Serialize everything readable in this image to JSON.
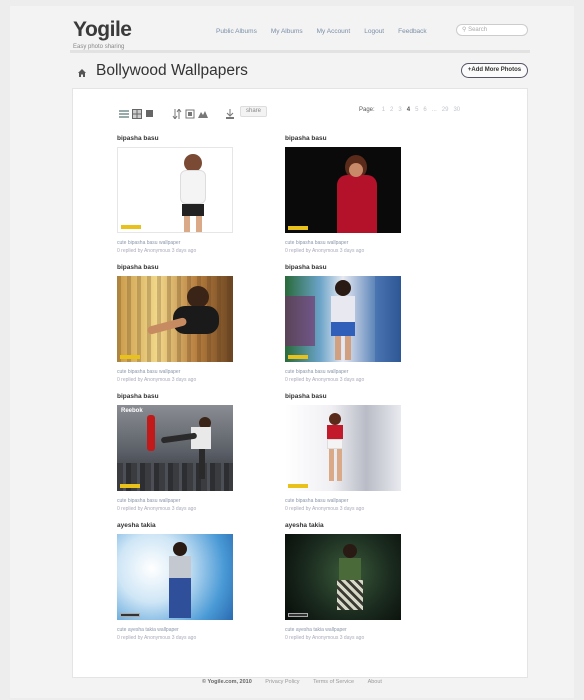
{
  "header": {
    "logo": "Yogile",
    "tagline": "Easy photo sharing",
    "nav": [
      "Public Albums",
      "My Albums",
      "My Account",
      "Logout",
      "Feedback"
    ],
    "search_placeholder": "Search"
  },
  "album": {
    "title": "Bollywood Wallpapers",
    "add_button": "+Add More Photos"
  },
  "toolbar": {
    "share_label": "share",
    "icons": [
      "list-view-icon",
      "grid-view-icon",
      "single-view-icon",
      "sort-icon",
      "slideshow-icon",
      "map-icon",
      "download-icon"
    ]
  },
  "pager": {
    "label": "Page:",
    "pages": [
      "1",
      "2",
      "3",
      "4",
      "5",
      "6",
      "...",
      "29",
      "30"
    ],
    "current": "4"
  },
  "photos": [
    {
      "name": "bipasha basu",
      "caption": "cute bipasha basu wallpaper",
      "meta": "0 replied by Anonymous 3 days ago"
    },
    {
      "name": "bipasha basu",
      "caption": "cute bipasha basu wallpaper",
      "meta": "0 replied by Anonymous 3 days ago"
    },
    {
      "name": "bipasha basu",
      "caption": "cute bipasha basu wallpaper",
      "meta": "0 replied by Anonymous 3 days ago"
    },
    {
      "name": "bipasha basu",
      "caption": "cute bipasha basu wallpaper",
      "meta": "0 replied by Anonymous 3 days ago"
    },
    {
      "name": "bipasha basu",
      "caption": "cute bipasha basu wallpaper",
      "meta": "0 replied by Anonymous 3 days ago",
      "overlay": "Reebok"
    },
    {
      "name": "bipasha basu",
      "caption": "cute bipasha basu wallpaper",
      "meta": "0 replied by Anonymous 3 days ago"
    },
    {
      "name": "ayesha takia",
      "caption": "cute ayesha takia wallpaper",
      "meta": "0 replied by Anonymous 3 days ago"
    },
    {
      "name": "ayesha takia",
      "caption": "cute ayesha takia wallpaper",
      "meta": "0 replied by Anonymous 3 days ago"
    }
  ],
  "footer": {
    "copyright": "© Yogile.com, 2010",
    "links": [
      "Privacy Policy",
      "Terms of Service",
      "About"
    ]
  }
}
